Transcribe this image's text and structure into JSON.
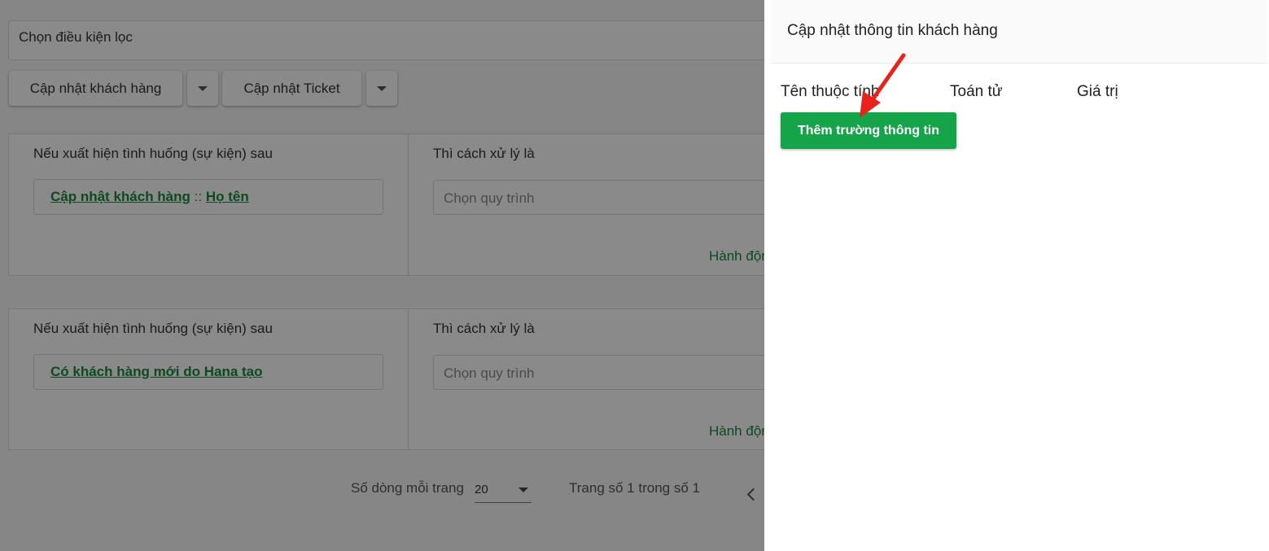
{
  "filter": {
    "placeholder": "Chọn điều kiện lọc"
  },
  "toolbar": {
    "update_customer_label": "Cập nhật khách hàng",
    "update_ticket_label": "Cập nhật Ticket"
  },
  "rules": [
    {
      "condition_label": "Nếu xuất hiện tình huống (sự kiện) sau",
      "event_link_1": "Cập nhật khách hàng",
      "separator": "::",
      "event_link_2": "Họ tên",
      "action_label": "Thì cách xử lý là",
      "process_placeholder": "Chọn quy trình",
      "action_link": "Hành động"
    },
    {
      "condition_label": "Nếu xuất hiện tình huống (sự kiện) sau",
      "event_link_1": "Có khách hàng mới do Hana tạo",
      "action_label": "Thì cách xử lý là",
      "process_placeholder": "Chọn quy trình",
      "action_link": "Hành động"
    }
  ],
  "pagination": {
    "rows_per_page_label": "Số dòng mỗi trang",
    "rows_per_page_value": "20",
    "page_info": "Trang số 1 trong số 1"
  },
  "drawer": {
    "title": "Cập nhật thông tin khách hàng",
    "columns": {
      "attribute": "Tên thuộc tính",
      "operator": "Toán tử",
      "value": "Giá trị"
    },
    "add_field_label": "Thêm trường thông tin"
  },
  "colors": {
    "accent_green": "#16a44a",
    "link_green": "#1a8a3c",
    "annotation_red": "#e8231b"
  }
}
